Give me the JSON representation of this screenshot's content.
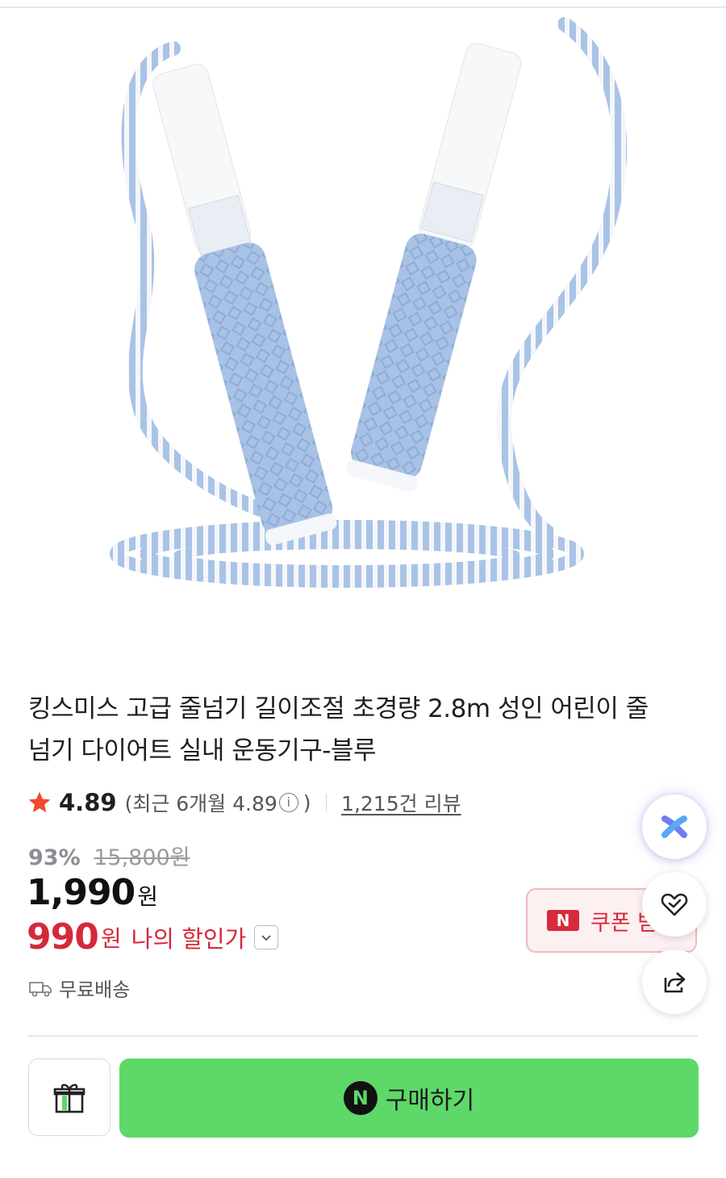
{
  "product": {
    "title": "킹스미스 고급 줄넘기 길이조절 초경량 2.8m 성인 어린이 줄넘기 다이어트 실내 운동기구-블루",
    "image": {
      "icon": "jump-rope-image"
    }
  },
  "rating": {
    "score": "4.89",
    "recent_label": "(최근 6개월 4.89",
    "recent_close": ")",
    "info_glyph": "i",
    "reviews": "1,215건 리뷰"
  },
  "pricing": {
    "discount_rate": "93%",
    "original_price": "15,800원",
    "price": "1,990",
    "price_unit": "원",
    "my_price": "990",
    "my_price_unit": "원",
    "my_price_label": "나의 할인가"
  },
  "shipping": {
    "label": "무료배송"
  },
  "coupon": {
    "badge": "N",
    "label": "쿠폰 받"
  },
  "bottom_bar": {
    "buy_badge": "N",
    "buy_label": "구매하기"
  },
  "colors": {
    "accent_red": "#d7283a",
    "buy_green": "#5fd86a",
    "rope_blue": "#a9c3e6"
  }
}
